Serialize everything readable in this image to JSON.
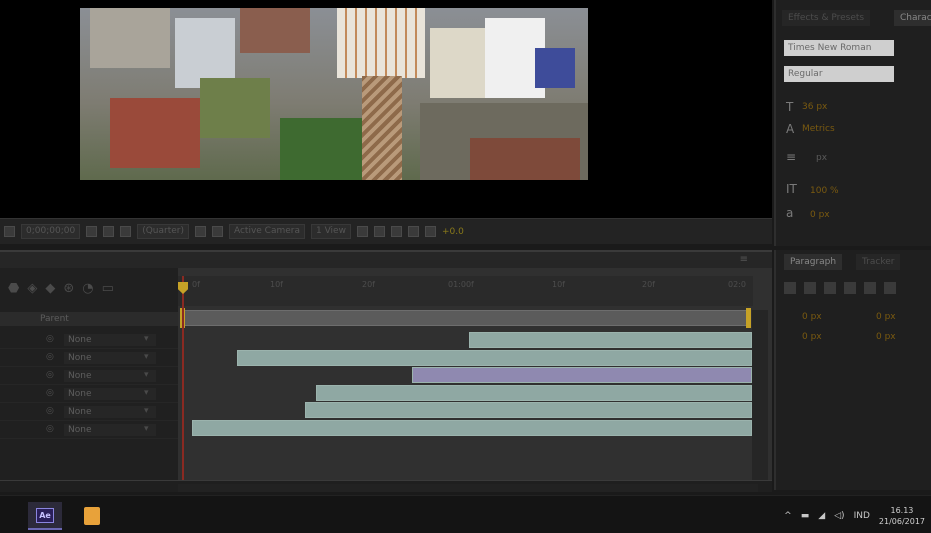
{
  "viewer": {
    "footage_description_icon": "aerial-city-footage",
    "toolbar": {
      "timecode": "0;00;00;00",
      "resolution": "(Quarter)",
      "camera": "Active Camera",
      "views": "1 View",
      "exposure": "+0.0"
    }
  },
  "timeline": {
    "column_header": "Parent",
    "ruler_ticks": [
      "0f",
      "10f",
      "20f",
      "01:00f",
      "10f",
      "20f",
      "02:0"
    ],
    "layers": [
      {
        "parent": "None"
      },
      {
        "parent": "None"
      },
      {
        "parent": "None"
      },
      {
        "parent": "None"
      },
      {
        "parent": "None"
      },
      {
        "parent": "None"
      }
    ],
    "bars": [
      {
        "start": 0.5,
        "end": 1.0,
        "color": "#8fa8a3"
      },
      {
        "start": 0.09,
        "end": 1.0,
        "color": "#8fa8a3"
      },
      {
        "start": 0.4,
        "end": 1.0,
        "color": "#8f89b0"
      },
      {
        "start": 0.23,
        "end": 1.0,
        "color": "#8fa8a3"
      },
      {
        "start": 0.21,
        "end": 1.0,
        "color": "#8fa8a3"
      },
      {
        "start": 0.01,
        "end": 1.0,
        "color": "#8fa8a3"
      }
    ]
  },
  "character_panel": {
    "tabs": [
      "Effects & Presets",
      "Character"
    ],
    "font_family": "Times New Roman",
    "font_style": "Regular",
    "font_size": "36 px",
    "tracking": "Metrics",
    "leading": "px",
    "vertical_scale": "100 %",
    "baseline_shift": "0 px"
  },
  "paragraph_panel": {
    "tabs": [
      "Paragraph",
      "Tracker"
    ],
    "indent_left": "0 px",
    "indent_right": "0 px",
    "space_before": "0 px",
    "space_after": "0 px"
  },
  "taskbar": {
    "apps": [
      "Ae",
      ""
    ],
    "language": "IND",
    "time": "16.13",
    "date": "21/06/2017"
  }
}
